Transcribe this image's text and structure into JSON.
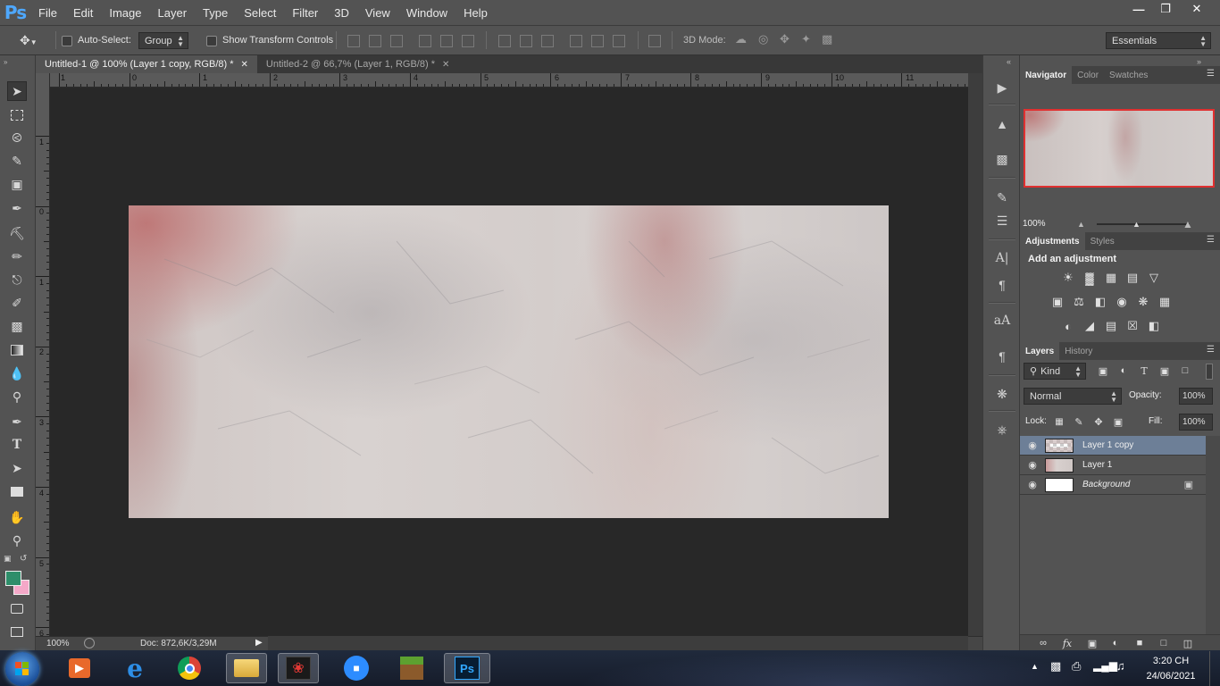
{
  "app": {
    "logo": "Ps"
  },
  "menu": [
    "File",
    "Edit",
    "Image",
    "Layer",
    "Type",
    "Select",
    "Filter",
    "3D",
    "View",
    "Window",
    "Help"
  ],
  "window_controls": {
    "minimize": "—",
    "restore": "❐",
    "close": "✕"
  },
  "options": {
    "auto_select_label": "Auto-Select:",
    "auto_select_value": "Group",
    "show_transform_label": "Show Transform Controls",
    "mode_label": "3D Mode:",
    "workspace": "Essentials"
  },
  "tabs": [
    {
      "title": "Untitled-1 @ 100% (Layer 1 copy, RGB/8) *",
      "close": "✕"
    },
    {
      "title": "Untitled-2 @ 66,7% (Layer 1, RGB/8) *",
      "close": "✕"
    }
  ],
  "ruler": {
    "h_labels": [
      "1",
      "0",
      "1",
      "2",
      "3",
      "4",
      "5",
      "6",
      "7",
      "8",
      "9",
      "10",
      "11"
    ],
    "v_labels": [
      "1",
      "0",
      "1",
      "2",
      "3",
      "4",
      "5",
      "6"
    ]
  },
  "status": {
    "zoom": "100%",
    "doc": "Doc: 872,6K/3,29M"
  },
  "navigator": {
    "tabs": [
      "Navigator",
      "Color",
      "Swatches"
    ],
    "zoom": "100%",
    "highlight_color": "#e03030"
  },
  "adjustments": {
    "tabs": [
      "Adjustments",
      "Styles"
    ],
    "heading": "Add an adjustment"
  },
  "layers_panel": {
    "tabs": [
      "Layers",
      "History"
    ],
    "filter_kind": "Kind",
    "blend_mode": "Normal",
    "opacity_label": "Opacity:",
    "opacity_value": "100%",
    "lock_label": "Lock:",
    "fill_label": "Fill:",
    "fill_value": "100%",
    "layers": [
      {
        "name": "Layer 1 copy",
        "selected": true
      },
      {
        "name": "Layer 1",
        "selected": false
      },
      {
        "name": "Background",
        "selected": false,
        "locked": true
      }
    ],
    "footer_icons": [
      "link-icon",
      "fx-icon",
      "mask-icon",
      "adjustment-layer-icon",
      "folder-icon",
      "new-layer-icon",
      "trash-icon"
    ],
    "fx_label": "fx"
  },
  "colors": {
    "foreground": "#2e8e6a",
    "background": "#f4a8c8",
    "accent": "#4ea8ff"
  },
  "taskbar": {
    "apps": [
      "start-orb",
      "media-player",
      "internet-explorer",
      "chrome",
      "file-explorer",
      "garena",
      "zoom",
      "minecraft",
      "photoshop"
    ],
    "time": "3:20 CH",
    "date": "24/06/2021"
  }
}
